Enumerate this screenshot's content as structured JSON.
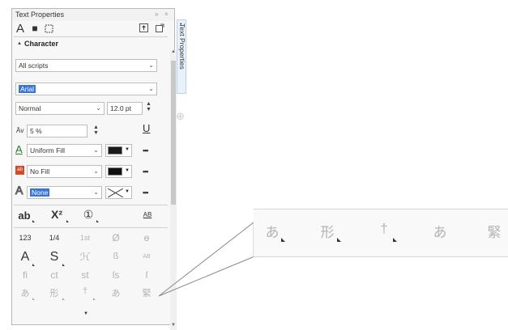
{
  "panel": {
    "title": "Text Properties",
    "title_controls": {
      "collapse": "»",
      "close": "×"
    },
    "tab_icons": [
      {
        "name": "character-tab-icon",
        "glyph": "A"
      },
      {
        "name": "paragraph-tab-icon",
        "glyph": "■"
      },
      {
        "name": "frame-tab-icon",
        "glyph": "⬚"
      }
    ],
    "section_title": "Character",
    "section_arrow": "▲",
    "scripts_value": "All scripts",
    "font_value": "Arial",
    "style_value": "Normal",
    "size_value": "12.0 pt",
    "spacing_label": "Āv",
    "spacing_value": "5 %",
    "underline_glyph": "U",
    "fill": {
      "icon": "A",
      "value": "Uniform Fill",
      "color": "#1a1a1a"
    },
    "background_fill": {
      "icon": "ab",
      "value": "No Fill",
      "color": "#111111"
    },
    "outline": {
      "icon": "A",
      "value": "None"
    },
    "more_label": "•••",
    "format_row": [
      "ab",
      "X²",
      "①",
      "AB"
    ],
    "more_arrow": "▼"
  },
  "glyph_grid": [
    {
      "text": "123",
      "muted": false
    },
    {
      "text": "1/4",
      "muted": false
    },
    {
      "text": "1st",
      "muted": true
    },
    {
      "text": "Ø",
      "muted": true
    },
    {
      "text": "ɵ",
      "muted": true
    },
    {
      "text": "A",
      "muted": false
    },
    {
      "text": "S",
      "muted": false
    },
    {
      "text": "ℋ",
      "muted": true
    },
    {
      "text": "ß",
      "muted": true
    },
    {
      "text": "AB",
      "muted": true
    },
    {
      "text": "ﬁ",
      "muted": true
    },
    {
      "text": "ct",
      "muted": true
    },
    {
      "text": "st",
      "muted": true
    },
    {
      "text": "ſs",
      "muted": true
    },
    {
      "text": "ſ",
      "muted": true
    },
    {
      "text": "あ",
      "muted": true
    },
    {
      "text": "形",
      "muted": true
    },
    {
      "text": "†",
      "muted": true
    },
    {
      "text": "あ",
      "muted": true
    },
    {
      "text": "緊",
      "muted": true
    }
  ],
  "side_tab": {
    "label": "Text Properties"
  },
  "add_tab_icon": "⊕",
  "zoom_glyphs": [
    "あ",
    "形",
    "†",
    "あ",
    "緊"
  ],
  "colors": {
    "panel_bg": "#f7f7f7",
    "highlight": "#3875d7",
    "tab_bg": "#e9f2fb"
  }
}
